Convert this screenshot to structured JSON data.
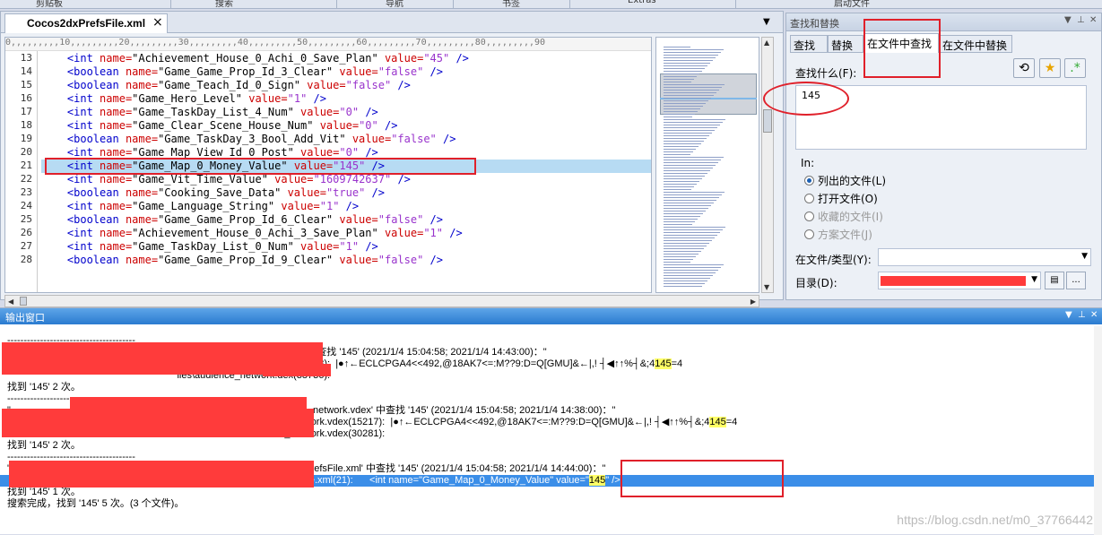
{
  "ribbon": {
    "labels": [
      "剪贴板",
      "搜索",
      "导航",
      "书签",
      "Extras",
      "启动文件"
    ]
  },
  "editor": {
    "tab_title": "Cocos2dxPrefsFile.xml",
    "close_glyph": "×",
    "ruler": "0,,,,,,,,,10,,,,,,,,,20,,,,,,,,,30,,,,,,,,,40,,,,,,,,,50,,,,,,,,,60,,,,,,,,,70,,,,,,,,,80,,,,,,,,,90",
    "lines": [
      {
        "n": "13",
        "tag": "<int",
        "name": "Achievement_House_0_Achi_0_Save_Plan",
        "value": "45"
      },
      {
        "n": "14",
        "tag": "<boolean",
        "name": "Game_Game_Prop_Id_3_Clear",
        "value": "false"
      },
      {
        "n": "15",
        "tag": "<boolean",
        "name": "Game_Teach_Id_0_Sign",
        "value": "false"
      },
      {
        "n": "16",
        "tag": "<int",
        "name": "Game_Hero_Level",
        "value": "1"
      },
      {
        "n": "17",
        "tag": "<int",
        "name": "Game_TaskDay_List_4_Num",
        "value": "0"
      },
      {
        "n": "18",
        "tag": "<int",
        "name": "Game_Clear_Scene_House_Num",
        "value": "0"
      },
      {
        "n": "19",
        "tag": "<boolean",
        "name": "Game_TaskDay_3_Bool_Add_Vit",
        "value": "false"
      },
      {
        "n": "20",
        "tag": "<int",
        "name": "Game_Map_View_Id_0_Post",
        "value": "0"
      },
      {
        "n": "21",
        "tag": "<int",
        "name": "Game_Map_0_Money_Value",
        "value": "145"
      },
      {
        "n": "22",
        "tag": "<int",
        "name": "Game_Vit_Time_Value",
        "value": "1609742637"
      },
      {
        "n": "23",
        "tag": "<boolean",
        "name": "Cooking_Save_Data",
        "value": "true"
      },
      {
        "n": "24",
        "tag": "<int",
        "name": "Game_Language_String",
        "value": "1"
      },
      {
        "n": "25",
        "tag": "<boolean",
        "name": "Game_Game_Prop_Id_6_Clear",
        "value": "false"
      },
      {
        "n": "26",
        "tag": "<int",
        "name": "Achievement_House_0_Achi_3_Save_Plan",
        "value": "1"
      },
      {
        "n": "27",
        "tag": "<int",
        "name": "Game_TaskDay_List_0_Num",
        "value": "1"
      },
      {
        "n": "28",
        "tag": "<boolean",
        "name": "Game_Game_Prop_Id_9_Clear",
        "value": "false"
      }
    ],
    "highlight_line": "21"
  },
  "find": {
    "title": "查找和替换",
    "tabs": [
      "查找",
      "替换",
      "在文件中查找",
      "在文件中替换"
    ],
    "active_tab": "在文件中查找",
    "find_label": "查找什么(F):",
    "find_value": "145",
    "in_label": "In:",
    "options": [
      {
        "label": "列出的文件(L)",
        "checked": true,
        "disabled": false
      },
      {
        "label": "打开文件(O)",
        "checked": false,
        "disabled": false
      },
      {
        "label": "收藏的文件(I)",
        "checked": false,
        "disabled": true
      },
      {
        "label": "方案文件(J)",
        "checked": false,
        "disabled": true
      }
    ],
    "file_type_label": "在文件/类型(Y):",
    "dir_label": "目录(D):",
    "browse_label": "..."
  },
  "output": {
    "title": "输出窗口",
    "lines": [
      {
        "t": "---------------------------------------"
      },
      {
        "t": "\"                                                              \\files\\audience_network.dex' 中查找 '145' (2021/1/4 15:04:58; 2021/1/4 14:43:00)：\""
      },
      {
        "t": "                                                              iles\\audience_network.dex(22543):  |●↑←ECLCPGA4<<492,@18AK7<=:M??9:D=Q[GMU]&←|,! ┤◀↑↑%┤&;4",
        "hl": "145",
        "after": "=4"
      },
      {
        "t": "                                                              iles\\audience_network.dex(38736):"
      },
      {
        "t": "找到 '145' 2 次。"
      },
      {
        "t": "---------------------------------------"
      },
      {
        "t": "\"                                                           'Aaaa\\files\\oat\\arm64\\audience_network.vdex' 中查找 '145' (2021/1/4 15:04:58; 2021/1/4 14:38:00)：\""
      },
      {
        "t": "I                                                          a\\files\\oat\\arm64\\audience_network.vdex(15217):  |●↑←ECLCPGA4<<492,@18AK7<=:M??9:D=Q[GMU]&←|,! ┤◀↑↑%┤&;4",
        "hl": "145",
        "after": "=4"
      },
      {
        "t": "I                                                          a\\files\\oat\\arm64\\audience_network.vdex(30281):"
      },
      {
        "t": "找到 '145' 2 次。"
      },
      {
        "t": "---------------------------------------"
      },
      {
        "t": "\"                                                           'Aaaa\\shared_prefs\\Cocos2dxPrefsFile.xml' 中查找 '145' (2021/1/4 15:04:58; 2021/1/4 14:44:00)：\""
      },
      {
        "t": "                                                           \\shared_prefs\\Cocos2dxPrefsFile.xml(21):      <int name=\"Game_Map_0_Money_Value\" value=\"",
        "hl": "145",
        "after": "\" />",
        "selected": true
      },
      {
        "t": "找到 '145' 1 次。"
      },
      {
        "t": "搜索完成，找到 '145' 5 次。(3 个文件)。"
      }
    ]
  },
  "watermark": "https://blog.csdn.net/m0_37766442",
  "colors": {
    "annotation": "#e0202a",
    "redaction": "#ff3b3b",
    "selection": "#3b8ee8",
    "line_highlight": "#b7dbf3"
  }
}
